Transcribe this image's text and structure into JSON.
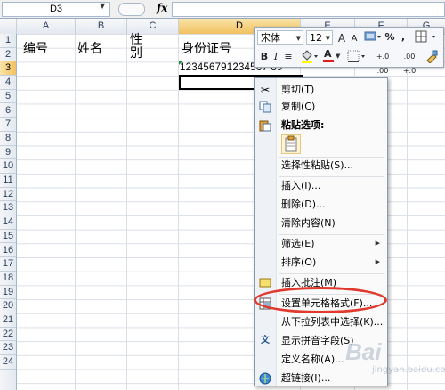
{
  "formula_bar": {
    "name_box": "D3",
    "fx_label": "fx",
    "formula": ""
  },
  "columns": [
    "A",
    "B",
    "C",
    "D",
    "E",
    "F",
    "G"
  ],
  "rows": [
    "1",
    "2",
    "3",
    "4",
    "5",
    "6",
    "7",
    "8",
    "9",
    "10",
    "11",
    "12",
    "13",
    "14",
    "15",
    "16",
    "17",
    "18",
    "19",
    "20",
    "21",
    "22",
    "23",
    "24"
  ],
  "cells": {
    "a1": "编号",
    "b1": "姓名",
    "c1_line1": "性",
    "c1_line2": "别",
    "d1": "身份证号",
    "d2": "123456791234567 89"
  },
  "mini_toolbar": {
    "font_name": "宋体",
    "font_size": "12",
    "grow_font": "A",
    "shrink_font": "A",
    "percent": "%",
    "comma": ",",
    "bold": "B",
    "italic": "I",
    "font_color_letter": "A",
    "dec_inc": "+.0 .00",
    "dec_dec": ".00 +.0"
  },
  "context_menu": {
    "items": [
      {
        "label": "剪切(T)",
        "icon": "scissors-icon"
      },
      {
        "label": "复制(C)",
        "icon": "copy-icon"
      },
      {
        "label": "粘贴选项:",
        "icon": "paste-icon"
      },
      {
        "label": "选择性粘贴(S)..."
      },
      {
        "label": "插入(I)..."
      },
      {
        "label": "删除(D)..."
      },
      {
        "label": "清除内容(N)"
      },
      {
        "label": "筛选(E)"
      },
      {
        "label": "排序(O)"
      },
      {
        "label": "插入批注(M)",
        "icon": "comment-icon"
      },
      {
        "label": "设置单元格格式(F)...",
        "icon": "format-cells-icon"
      },
      {
        "label": "从下拉列表中选择(K)..."
      },
      {
        "label": "显示拼音字段(S)",
        "icon": "phonetic-icon"
      },
      {
        "label": "定义名称(A)..."
      },
      {
        "label": "超链接(I)...",
        "icon": "hyperlink-icon"
      }
    ]
  },
  "watermark": {
    "text": "Bai",
    "sub": "jingyan.baidu.com"
  },
  "colors": {
    "selected_header": "#f1c15f",
    "highlight_oval": "#e03a2e"
  }
}
